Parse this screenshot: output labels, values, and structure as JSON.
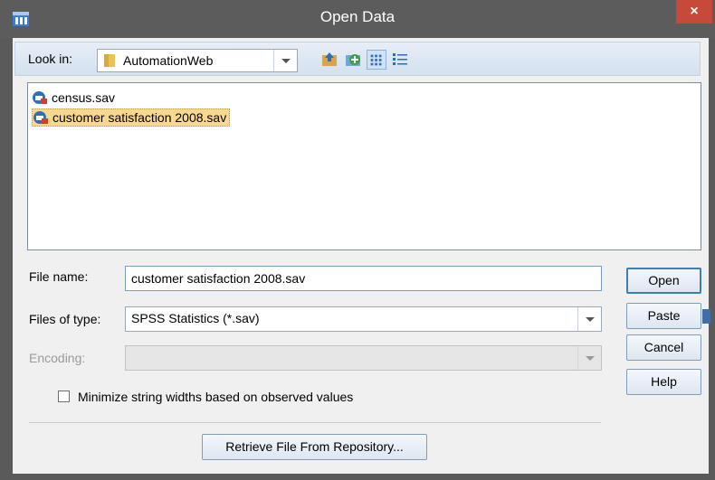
{
  "window": {
    "title": "Open Data",
    "close_label": "×"
  },
  "toolbar": {
    "look_in_label": "Look in:",
    "look_in_value": "AutomationWeb",
    "icons": [
      "up-folder-icon",
      "new-folder-icon",
      "list-view-icon",
      "details-view-icon"
    ]
  },
  "files": [
    {
      "name": "census.sav",
      "selected": false
    },
    {
      "name": "customer satisfaction 2008.sav",
      "selected": true
    }
  ],
  "form": {
    "file_name_label": "File name:",
    "file_name_value": "customer satisfaction 2008.sav",
    "files_of_type_label": "Files of type:",
    "files_of_type_value": "SPSS Statistics (*.sav)",
    "encoding_label": "Encoding:",
    "encoding_value": "",
    "minimize_label": "Minimize string widths based on observed values",
    "minimize_checked": false
  },
  "buttons": {
    "open": "Open",
    "paste": "Paste",
    "cancel": "Cancel",
    "help": "Help",
    "retrieve": "Retrieve File From Repository..."
  },
  "colors": {
    "titlebar": "#5c5c5c",
    "close": "#c7493a",
    "selection": "#f8d88c",
    "accent": "#3c7fb1"
  }
}
